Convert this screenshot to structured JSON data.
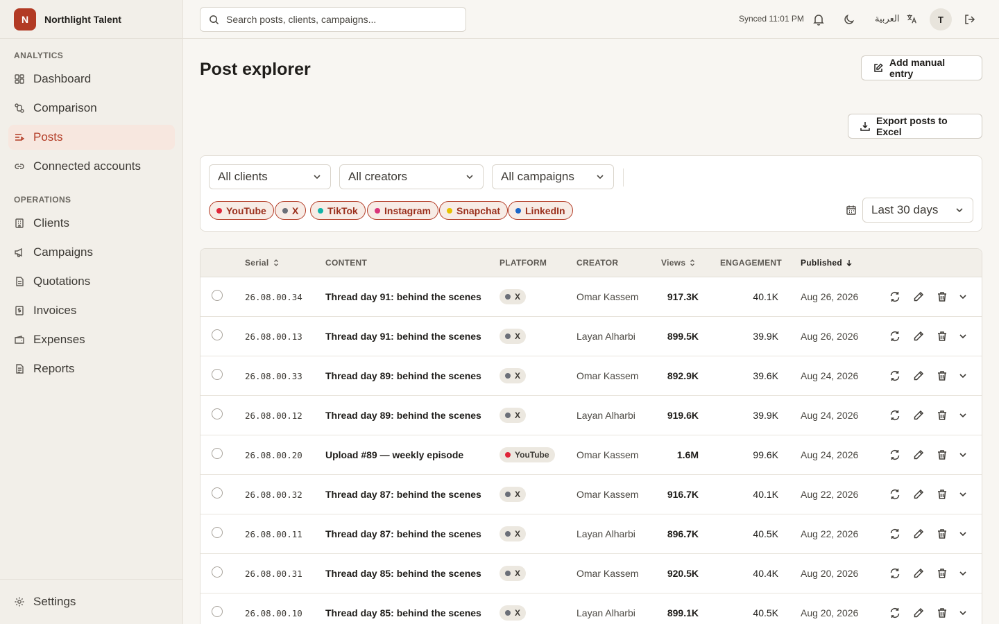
{
  "brand": {
    "initial": "N",
    "name": "Northlight Talent",
    "color": "#b23a24"
  },
  "sidebar": {
    "sections": [
      {
        "label": "ANALYTICS",
        "items": [
          {
            "label": "Dashboard",
            "icon": "dashboard-icon"
          },
          {
            "label": "Comparison",
            "icon": "compare-icon"
          },
          {
            "label": "Posts",
            "icon": "posts-icon",
            "active": true
          },
          {
            "label": "Connected accounts",
            "icon": "link-icon"
          }
        ]
      },
      {
        "label": "OPERATIONS",
        "items": [
          {
            "label": "Clients",
            "icon": "building-icon"
          },
          {
            "label": "Campaigns",
            "icon": "megaphone-icon"
          },
          {
            "label": "Quotations",
            "icon": "quotation-icon"
          },
          {
            "label": "Invoices",
            "icon": "invoice-icon"
          },
          {
            "label": "Expenses",
            "icon": "wallet-icon"
          },
          {
            "label": "Reports",
            "icon": "report-icon"
          }
        ]
      }
    ],
    "settings_label": "Settings"
  },
  "topbar": {
    "search_placeholder": "Search posts, clients, campaigns...",
    "synced": "Synced 11:01 PM",
    "language": "العربية",
    "avatar_initial": "T"
  },
  "main": {
    "title": "Post explorer",
    "add_button": "Add manual entry",
    "export_button": "Export posts to Excel"
  },
  "filters": {
    "clients": "All clients",
    "creators": "All creators",
    "campaigns": "All campaigns",
    "date_range": "Last 30 days",
    "platforms": [
      {
        "label": "YouTube",
        "color": "#e0263a"
      },
      {
        "label": "X",
        "color": "#6b6f78"
      },
      {
        "label": "TikTok",
        "color": "#12b3a8"
      },
      {
        "label": "Instagram",
        "color": "#d9357a"
      },
      {
        "label": "Snapchat",
        "color": "#e6c200"
      },
      {
        "label": "LinkedIn",
        "color": "#1a66c9"
      }
    ]
  },
  "table": {
    "headers": {
      "serial": "Serial",
      "content": "CONTENT",
      "platform": "PLATFORM",
      "creator": "CREATOR",
      "views": "Views",
      "engagement": "ENGAGEMENT",
      "published": "Published"
    },
    "rows": [
      {
        "serial": "26.08.00.34",
        "content": "Thread day 91: behind the scenes",
        "platform": "X",
        "platform_color": "#6b6f78",
        "creator": "Omar Kassem",
        "views": "917.3K",
        "engagement": "40.1K",
        "published": "Aug 26, 2026"
      },
      {
        "serial": "26.08.00.13",
        "content": "Thread day 91: behind the scenes",
        "platform": "X",
        "platform_color": "#6b6f78",
        "creator": "Layan Alharbi",
        "views": "899.5K",
        "engagement": "39.9K",
        "published": "Aug 26, 2026"
      },
      {
        "serial": "26.08.00.33",
        "content": "Thread day 89: behind the scenes",
        "platform": "X",
        "platform_color": "#6b6f78",
        "creator": "Omar Kassem",
        "views": "892.9K",
        "engagement": "39.6K",
        "published": "Aug 24, 2026"
      },
      {
        "serial": "26.08.00.12",
        "content": "Thread day 89: behind the scenes",
        "platform": "X",
        "platform_color": "#6b6f78",
        "creator": "Layan Alharbi",
        "views": "919.6K",
        "engagement": "39.9K",
        "published": "Aug 24, 2026"
      },
      {
        "serial": "26.08.00.20",
        "content": "Upload #89 — weekly episode",
        "platform": "YouTube",
        "platform_color": "#e0263a",
        "creator": "Omar Kassem",
        "views": "1.6M",
        "engagement": "99.6K",
        "published": "Aug 24, 2026"
      },
      {
        "serial": "26.08.00.32",
        "content": "Thread day 87: behind the scenes",
        "platform": "X",
        "platform_color": "#6b6f78",
        "creator": "Omar Kassem",
        "views": "916.7K",
        "engagement": "40.1K",
        "published": "Aug 22, 2026"
      },
      {
        "serial": "26.08.00.11",
        "content": "Thread day 87: behind the scenes",
        "platform": "X",
        "platform_color": "#6b6f78",
        "creator": "Layan Alharbi",
        "views": "896.7K",
        "engagement": "40.5K",
        "published": "Aug 22, 2026"
      },
      {
        "serial": "26.08.00.31",
        "content": "Thread day 85: behind the scenes",
        "platform": "X",
        "platform_color": "#6b6f78",
        "creator": "Omar Kassem",
        "views": "920.5K",
        "engagement": "40.4K",
        "published": "Aug 20, 2026"
      },
      {
        "serial": "26.08.00.10",
        "content": "Thread day 85: behind the scenes",
        "platform": "X",
        "platform_color": "#6b6f78",
        "creator": "Layan Alharbi",
        "views": "899.1K",
        "engagement": "40.5K",
        "published": "Aug 20, 2026"
      }
    ]
  }
}
